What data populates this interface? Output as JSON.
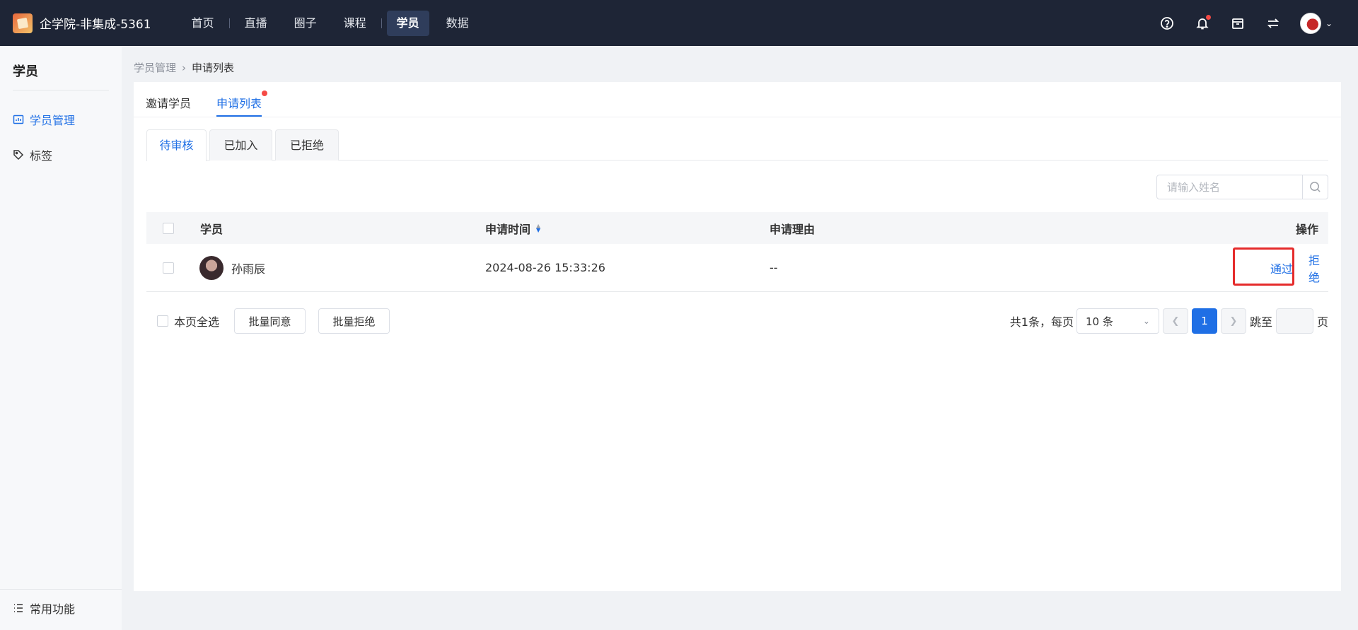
{
  "app": {
    "title": "企学院-非集成-5361"
  },
  "nav": {
    "items": [
      {
        "label": "首页"
      },
      {
        "label": "直播"
      },
      {
        "label": "圈子"
      },
      {
        "label": "课程"
      },
      {
        "label": "学员",
        "active": true
      },
      {
        "label": "数据"
      }
    ]
  },
  "top_icons": [
    "help-icon",
    "bell-icon",
    "store-icon",
    "switch-icon",
    "user-avatar"
  ],
  "sidebar": {
    "title": "学员",
    "items": [
      {
        "label": "学员管理",
        "icon": "chart-icon",
        "active": true
      },
      {
        "label": "标签",
        "icon": "tag-icon"
      }
    ],
    "bottom": {
      "label": "常用功能",
      "icon": "list-icon"
    }
  },
  "breadcrumb": {
    "parent": "学员管理",
    "current": "申请列表"
  },
  "tabs": [
    {
      "label": "邀请学员"
    },
    {
      "label": "申请列表",
      "active": true,
      "dot": true
    }
  ],
  "subtabs": [
    {
      "label": "待审核",
      "active": true
    },
    {
      "label": "已加入"
    },
    {
      "label": "已拒绝"
    }
  ],
  "search": {
    "placeholder": "请输入姓名"
  },
  "table": {
    "columns": {
      "student": "学员",
      "apply_time": "申请时间",
      "reason": "申请理由",
      "action": "操作"
    },
    "rows": [
      {
        "name": "孙雨辰",
        "apply_time": "2024-08-26 15:33:26",
        "reason": "--",
        "approve": "通过",
        "reject": "拒绝"
      }
    ]
  },
  "footer": {
    "select_all": "本页全选",
    "batch_approve": "批量同意",
    "batch_reject": "批量拒绝"
  },
  "pager": {
    "total_text": "共1条，每页",
    "page_size": "10 条",
    "current_page": "1",
    "jump_label": "跳至",
    "page_suffix": "页"
  },
  "colors": {
    "topbar": "#1e2536",
    "accent": "#1f6fe5",
    "highlight": "#e52b2b"
  }
}
